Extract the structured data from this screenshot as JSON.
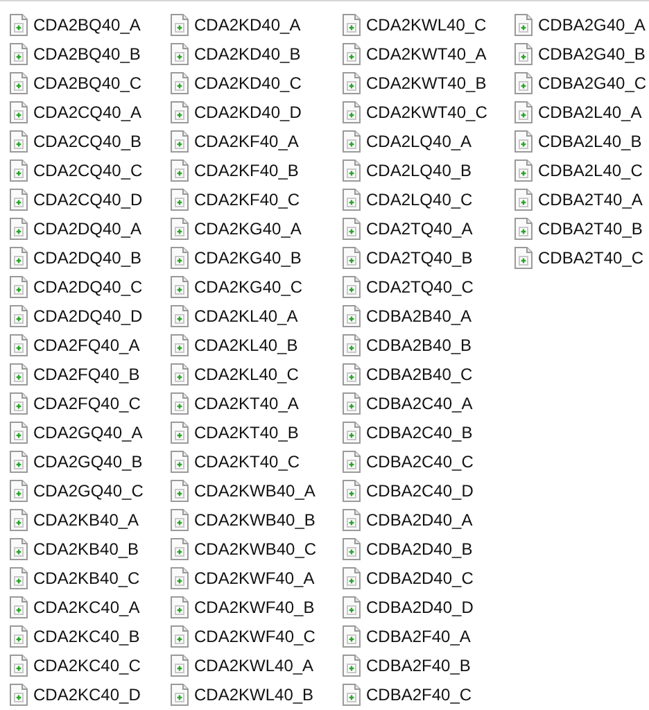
{
  "files": [
    "CDA2BQ40_A",
    "CDA2BQ40_B",
    "CDA2BQ40_C",
    "CDA2CQ40_A",
    "CDA2CQ40_B",
    "CDA2CQ40_C",
    "CDA2CQ40_D",
    "CDA2DQ40_A",
    "CDA2DQ40_B",
    "CDA2DQ40_C",
    "CDA2DQ40_D",
    "CDA2FQ40_A",
    "CDA2FQ40_B",
    "CDA2FQ40_C",
    "CDA2GQ40_A",
    "CDA2GQ40_B",
    "CDA2GQ40_C",
    "CDA2KB40_A",
    "CDA2KB40_B",
    "CDA2KB40_C",
    "CDA2KC40_A",
    "CDA2KC40_B",
    "CDA2KC40_C",
    "CDA2KC40_D",
    "CDA2KD40_A",
    "CDA2KD40_B",
    "CDA2KD40_C",
    "CDA2KD40_D",
    "CDA2KF40_A",
    "CDA2KF40_B",
    "CDA2KF40_C",
    "CDA2KG40_A",
    "CDA2KG40_B",
    "CDA2KG40_C",
    "CDA2KL40_A",
    "CDA2KL40_B",
    "CDA2KL40_C",
    "CDA2KT40_A",
    "CDA2KT40_B",
    "CDA2KT40_C",
    "CDA2KWB40_A",
    "CDA2KWB40_B",
    "CDA2KWB40_C",
    "CDA2KWF40_A",
    "CDA2KWF40_B",
    "CDA2KWF40_C",
    "CDA2KWL40_A",
    "CDA2KWL40_B",
    "CDA2KWL40_C",
    "CDA2KWT40_A",
    "CDA2KWT40_B",
    "CDA2KWT40_C",
    "CDA2LQ40_A",
    "CDA2LQ40_B",
    "CDA2LQ40_C",
    "CDA2TQ40_A",
    "CDA2TQ40_B",
    "CDA2TQ40_C",
    "CDBA2B40_A",
    "CDBA2B40_B",
    "CDBA2B40_C",
    "CDBA2C40_A",
    "CDBA2C40_B",
    "CDBA2C40_C",
    "CDBA2C40_D",
    "CDBA2D40_A",
    "CDBA2D40_B",
    "CDBA2D40_C",
    "CDBA2D40_D",
    "CDBA2F40_A",
    "CDBA2F40_B",
    "CDBA2F40_C",
    "CDBA2G40_A",
    "CDBA2G40_B",
    "CDBA2G40_C",
    "CDBA2L40_A",
    "CDBA2L40_B",
    "CDBA2L40_C",
    "CDBA2T40_A",
    "CDBA2T40_B",
    "CDBA2T40_C"
  ]
}
